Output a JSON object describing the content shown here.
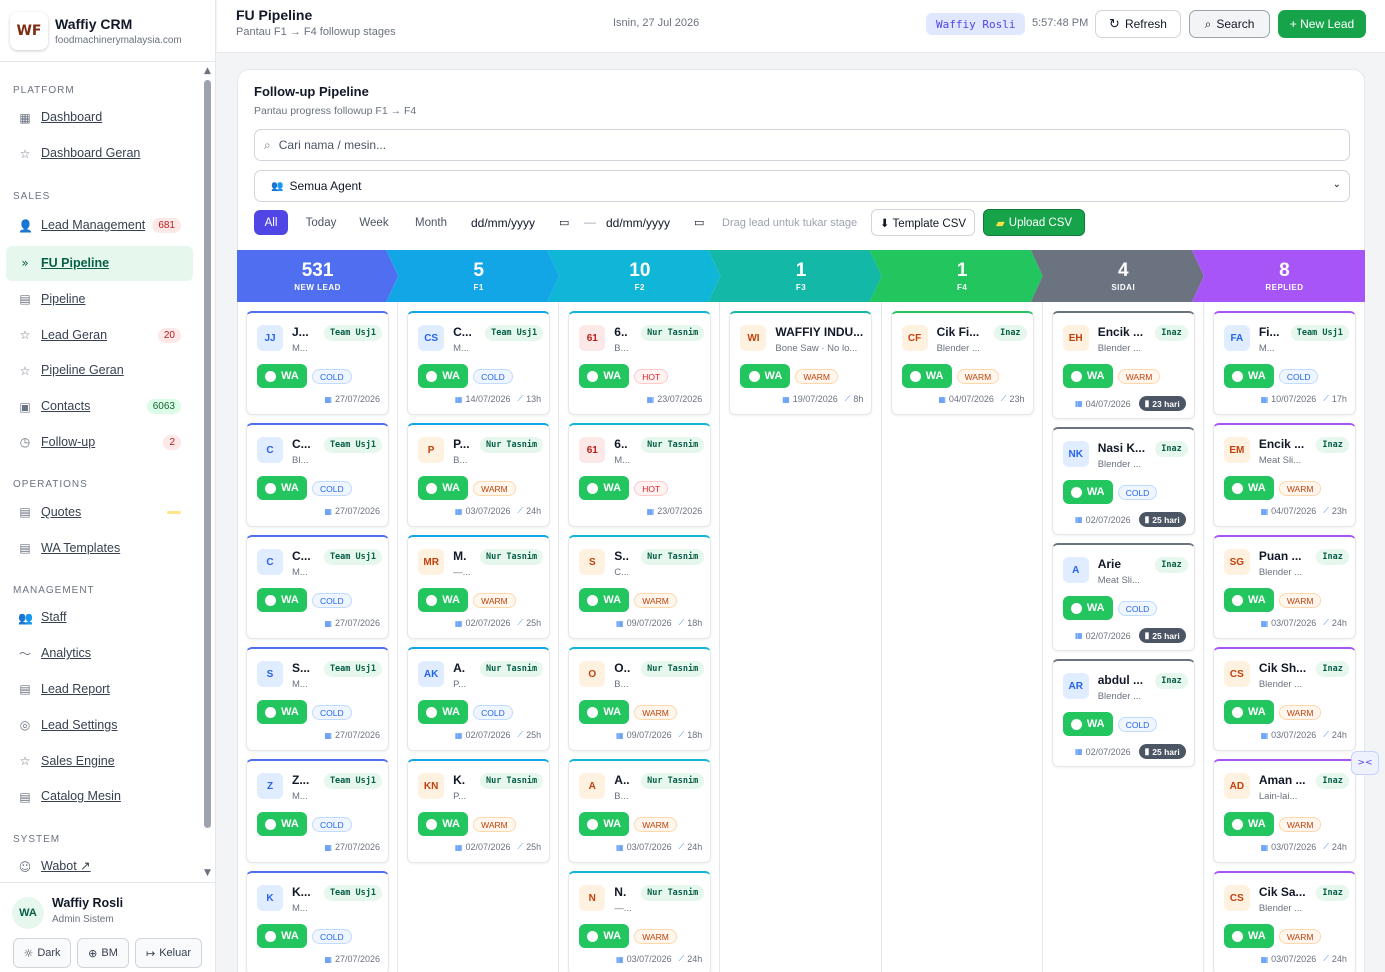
{
  "brand": {
    "logo": "WF",
    "name": "Waffiy CRM",
    "domain": "foodmachinerymalaysia.com"
  },
  "nav": {
    "sections": [
      {
        "title": "PLATFORM",
        "items": [
          {
            "label": "Dashboard",
            "icon": "grid-icon"
          },
          {
            "label": "Dashboard Geran",
            "icon": "star-icon"
          }
        ]
      },
      {
        "title": "SALES",
        "items": [
          {
            "label": "Lead Management",
            "icon": "user-icon",
            "badge": "681"
          },
          {
            "label": "FU Pipeline",
            "icon": "pipeline-icon",
            "active": true
          },
          {
            "label": "Pipeline",
            "icon": "table-icon"
          },
          {
            "label": "Lead Geran",
            "icon": "star-icon",
            "badge": "20"
          },
          {
            "label": "Pipeline Geran",
            "icon": "star-icon"
          },
          {
            "label": "Contacts",
            "icon": "contact-icon",
            "badge": "6063"
          },
          {
            "label": "Follow-up",
            "icon": "clock-icon",
            "badge": "2"
          }
        ]
      },
      {
        "title": "OPERATIONS",
        "items": [
          {
            "label": "Quotes",
            "icon": "document-icon"
          },
          {
            "label": "WA Templates",
            "icon": "document-icon"
          }
        ]
      },
      {
        "title": "MANAGEMENT",
        "items": [
          {
            "label": "Staff",
            "icon": "users-icon"
          },
          {
            "label": "Analytics",
            "icon": "trend-icon"
          },
          {
            "label": "Lead Report",
            "icon": "report-icon"
          },
          {
            "label": "Lead Settings",
            "icon": "settings-icon"
          },
          {
            "label": "Sales Engine",
            "icon": "star-icon"
          },
          {
            "label": "Catalog Mesin",
            "icon": "table-icon"
          }
        ]
      },
      {
        "title": "SYSTEM",
        "items": [
          {
            "label": "Wabot ↗",
            "icon": "bot-icon"
          }
        ]
      }
    ]
  },
  "profile": {
    "initials": "WA",
    "name": "Waffiy Rosli",
    "role": "Admin Sistem",
    "dark_label": "Dark",
    "lang_label": "BM",
    "logout_label": "Keluar"
  },
  "topbar": {
    "title": "FU Pipeline",
    "subtitle": "Pantau F1 → F4 followup stages",
    "date": "Isnin, 27 Jul 2026",
    "user": "Waffiy Rosli",
    "time": "5:57:48 PM",
    "refresh_label": "Refresh",
    "search_label": "Search",
    "new_lead_label": "+ New Lead"
  },
  "card": {
    "title": "Follow-up Pipeline",
    "subtitle": "Pantau progress followup F1 → F4",
    "search_placeholder": "Cari nama / mesin...",
    "agent_filter": "Semua Agent",
    "filters": {
      "all": "All",
      "today": "Today",
      "week": "Week",
      "month": "Month"
    },
    "date_from": "dd/mm/yyyy",
    "date_to": "dd/mm/yyyy",
    "drag_hint": "Drag lead untuk tukar stage",
    "template_csv": "⬇ Template CSV",
    "upload_csv": "Upload CSV"
  },
  "colors": {
    "primary": "#4f46e5",
    "green": "#16a34a"
  },
  "stages": [
    {
      "count": "531",
      "name": "NEW LEAD",
      "color": "#4f6ef0"
    },
    {
      "count": "5",
      "name": "F1",
      "color": "#13a6e6"
    },
    {
      "count": "10",
      "name": "F2",
      "color": "#0fb6d8"
    },
    {
      "count": "1",
      "name": "F3",
      "color": "#14b8a6"
    },
    {
      "count": "1",
      "name": "F4",
      "color": "#22c55e"
    },
    {
      "count": "4",
      "name": "SIDAI",
      "color": "#6b7280"
    },
    {
      "count": "8",
      "name": "REPLIED",
      "color": "#a855f7"
    }
  ],
  "columns": [
    {
      "cards": [
        {
          "ini": "JJ",
          "name": "J...",
          "sub": "M...",
          "agent": "Team Usj1",
          "temp": "COLD",
          "date": "27/07/2026"
        },
        {
          "ini": "C",
          "name": "C...",
          "sub": "Bl...",
          "agent": "Team Usj1",
          "temp": "COLD",
          "date": "27/07/2026"
        },
        {
          "ini": "C",
          "name": "C...",
          "sub": "M...",
          "agent": "Team Usj1",
          "temp": "COLD",
          "date": "27/07/2026"
        },
        {
          "ini": "S",
          "name": "S...",
          "sub": "M...",
          "agent": "Team Usj1",
          "temp": "COLD",
          "date": "27/07/2026"
        },
        {
          "ini": "Z",
          "name": "Z...",
          "sub": "M...",
          "agent": "Team Usj1",
          "temp": "COLD",
          "date": "27/07/2026"
        },
        {
          "ini": "K",
          "name": "K...",
          "sub": "M...",
          "agent": "Team Usj1",
          "temp": "COLD",
          "date": "27/07/2026"
        }
      ]
    },
    {
      "cards": [
        {
          "ini": "CS",
          "name": "C...",
          "sub": "M...",
          "agent": "Team Usj1",
          "temp": "COLD",
          "date": "14/07/2026",
          "age": "13h"
        },
        {
          "ini": "P",
          "name": "P...",
          "sub": "B...",
          "agent": "Nur Tasnim",
          "temp": "WARM",
          "date": "03/07/2026",
          "age": "24h"
        },
        {
          "ini": "MR",
          "name": "M.",
          "sub": "—...",
          "agent": "Nur Tasnim",
          "temp": "WARM",
          "date": "02/07/2026",
          "age": "25h"
        },
        {
          "ini": "AK",
          "name": "A.",
          "sub": "P...",
          "agent": "Nur Tasnim",
          "temp": "COLD",
          "date": "02/07/2026",
          "age": "25h"
        },
        {
          "ini": "KN",
          "name": "K.",
          "sub": "P...",
          "agent": "Nur Tasnim",
          "temp": "WARM",
          "date": "02/07/2026",
          "age": "25h"
        }
      ]
    },
    {
      "cards": [
        {
          "ini": "61",
          "name": "6..",
          "sub": "B...",
          "agent": "Nur Tasnim",
          "temp": "HOT",
          "date": "23/07/2026"
        },
        {
          "ini": "61",
          "name": "6..",
          "sub": "M...",
          "agent": "Nur Tasnim",
          "temp": "HOT",
          "date": "23/07/2026"
        },
        {
          "ini": "S",
          "name": "S..",
          "sub": "C...",
          "agent": "Nur Tasnim",
          "temp": "WARM",
          "date": "09/07/2026",
          "age": "18h"
        },
        {
          "ini": "O",
          "name": "O..",
          "sub": "B...",
          "agent": "Nur Tasnim",
          "temp": "WARM",
          "date": "09/07/2026",
          "age": "18h"
        },
        {
          "ini": "A",
          "name": "A..",
          "sub": "B...",
          "agent": "Nur Tasnim",
          "temp": "WARM",
          "date": "03/07/2026",
          "age": "24h"
        },
        {
          "ini": "N",
          "name": "N.",
          "sub": "—...",
          "agent": "Nur Tasnim",
          "temp": "WARM",
          "date": "03/07/2026",
          "age": "24h"
        }
      ]
    },
    {
      "cards": [
        {
          "ini": "WI",
          "name": "WAFFIY INDU...",
          "sub": "Bone Saw · No lo...",
          "temp": "WARM",
          "date": "19/07/2026",
          "age": "8h",
          "wide": true
        }
      ]
    },
    {
      "cards": [
        {
          "ini": "CF",
          "name": "Cik Fi...",
          "sub": "Blender ...",
          "agent": "Inaz",
          "temp": "WARM",
          "date": "04/07/2026",
          "age": "23h"
        }
      ]
    },
    {
      "cards": [
        {
          "ini": "EH",
          "name": "Encik ...",
          "sub": "Blender ...",
          "agent": "Inaz",
          "temp": "WARM",
          "date": "04/07/2026",
          "chip": "23 hari"
        },
        {
          "ini": "NK",
          "name": "Nasi K...",
          "sub": "Blender ...",
          "agent": "Inaz",
          "temp": "COLD",
          "date": "02/07/2026",
          "chip": "25 hari"
        },
        {
          "ini": "A",
          "name": "Arie",
          "sub": "Meat Sli...",
          "agent": "Inaz",
          "temp": "COLD",
          "date": "02/07/2026",
          "chip": "25 hari"
        },
        {
          "ini": "AR",
          "name": "abdul ...",
          "sub": "Blender ...",
          "agent": "Inaz",
          "temp": "COLD",
          "date": "02/07/2026",
          "chip": "25 hari"
        }
      ]
    },
    {
      "cards": [
        {
          "ini": "FA",
          "name": "Fi...",
          "sub": "M...",
          "agent": "Team Usj1",
          "temp": "COLD",
          "date": "10/07/2026",
          "age": "17h"
        },
        {
          "ini": "EM",
          "name": "Encik ...",
          "sub": "Meat Sli...",
          "agent": "Inaz",
          "temp": "WARM",
          "date": "04/07/2026",
          "age": "23h"
        },
        {
          "ini": "SG",
          "name": "Puan ...",
          "sub": "Blender ...",
          "agent": "Inaz",
          "temp": "WARM",
          "date": "03/07/2026",
          "age": "24h"
        },
        {
          "ini": "CS",
          "name": "Cik Sh...",
          "sub": "Blender ...",
          "agent": "Inaz",
          "temp": "WARM",
          "date": "03/07/2026",
          "age": "24h"
        },
        {
          "ini": "AD",
          "name": "Aman ...",
          "sub": "Lain-lai...",
          "agent": "Inaz",
          "temp": "WARM",
          "date": "03/07/2026",
          "age": "24h"
        },
        {
          "ini": "CS",
          "name": "Cik Sa...",
          "sub": "Blender ...",
          "agent": "Inaz",
          "temp": "WARM",
          "date": "03/07/2026",
          "age": "24h"
        }
      ]
    }
  ]
}
